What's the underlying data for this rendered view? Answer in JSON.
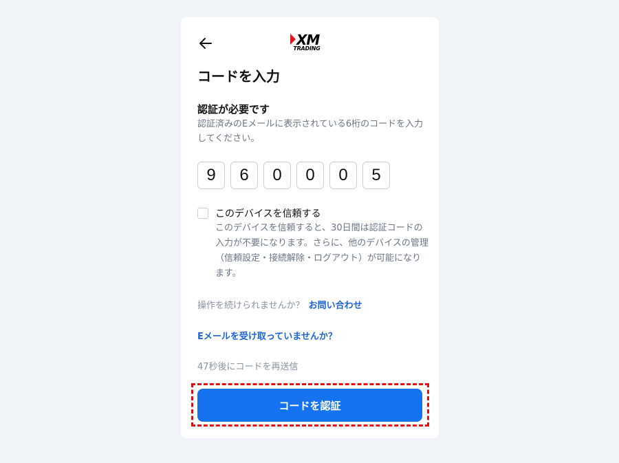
{
  "header": {
    "back_icon": "arrow-left-icon",
    "logo": {
      "word": "XM",
      "sub": "TRADING",
      "accent_color": "#e2141e"
    }
  },
  "page": {
    "title": "コードを入力",
    "section_title": "認証が必要です",
    "description": "認証済みのEメールに表示されている6桁のコードを入力してください。"
  },
  "code": {
    "digits": [
      "9",
      "6",
      "0",
      "0",
      "0",
      "5"
    ]
  },
  "trust_device": {
    "checked": false,
    "label": "このデバイスを信頼する",
    "description": "このデバイスを信頼すると、30日間は認証コードの入力が不要になります。さらに、他のデバイスの管理（信頼設定・接続解除・ログアウト）が可能になります。"
  },
  "help": {
    "prompt": "操作を続けられませんか？",
    "link": "お問い合わせ"
  },
  "email_link": "Eメールを受け取っていませんか？",
  "resend_text": "47秒後にコードを再送信",
  "submit_label": "コードを認証",
  "colors": {
    "primary": "#1573ef",
    "link": "#1d63d6",
    "highlight_border": "#e01010",
    "background": "#f0f3f8"
  }
}
